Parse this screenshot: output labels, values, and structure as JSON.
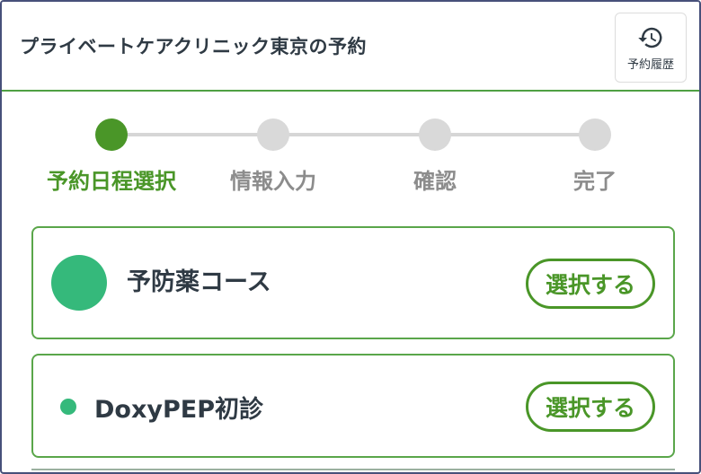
{
  "header": {
    "title": "プライベートケアクリニック東京の予約",
    "history_label": "予約履歴",
    "history_icon": "history-icon"
  },
  "stepper": {
    "steps": [
      {
        "label": "予約日程選択",
        "active": true
      },
      {
        "label": "情報入力",
        "active": false
      },
      {
        "label": "確認",
        "active": false
      },
      {
        "label": "完了",
        "active": false
      }
    ]
  },
  "courses": [
    {
      "title": "予防薬コース",
      "button": "選択する"
    },
    {
      "title": "DoxyPEP初診",
      "button": "選択する"
    }
  ],
  "colors": {
    "accent": "#4a9628",
    "course_dot": "#35b97b",
    "inactive": "#d9d9d9",
    "text": "#2f3a44"
  }
}
